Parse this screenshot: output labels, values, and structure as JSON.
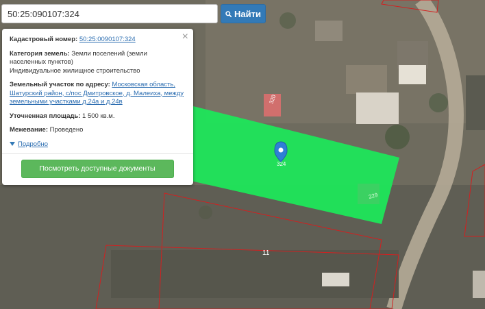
{
  "search": {
    "value": "50:25:090107:324",
    "button_label": "Найти"
  },
  "info": {
    "cadastral_label": "Кадастровый номер:",
    "cadastral_value": "50:25:0090107:324",
    "category_label": "Категория земель:",
    "category_value": "Земли поселений (земли населенных пунктов)",
    "usage": "Индивидуальное жилищное строительство",
    "address_label": "Земельный участок по адресу:",
    "address_value": "Московская область, Шатурский район, с/пос Дмитровское, д. Малеиха, между земельными участками д.24а и д.24в",
    "area_label": "Уточненная площадь:",
    "area_value": "1 500 кв.м.",
    "survey_label": "Межевание:",
    "survey_value": "Проведено",
    "more_link": "Подробно",
    "docs_button": "Посмотреть доступные документы",
    "close_glyph": "×"
  },
  "map": {
    "plot_label_selected": "324",
    "plot_label_adjacent": "320",
    "plot_label_small": "229",
    "plot_label_lower": "11",
    "highlight_color": "#1ee65a",
    "boundary_color": "#d22020"
  }
}
